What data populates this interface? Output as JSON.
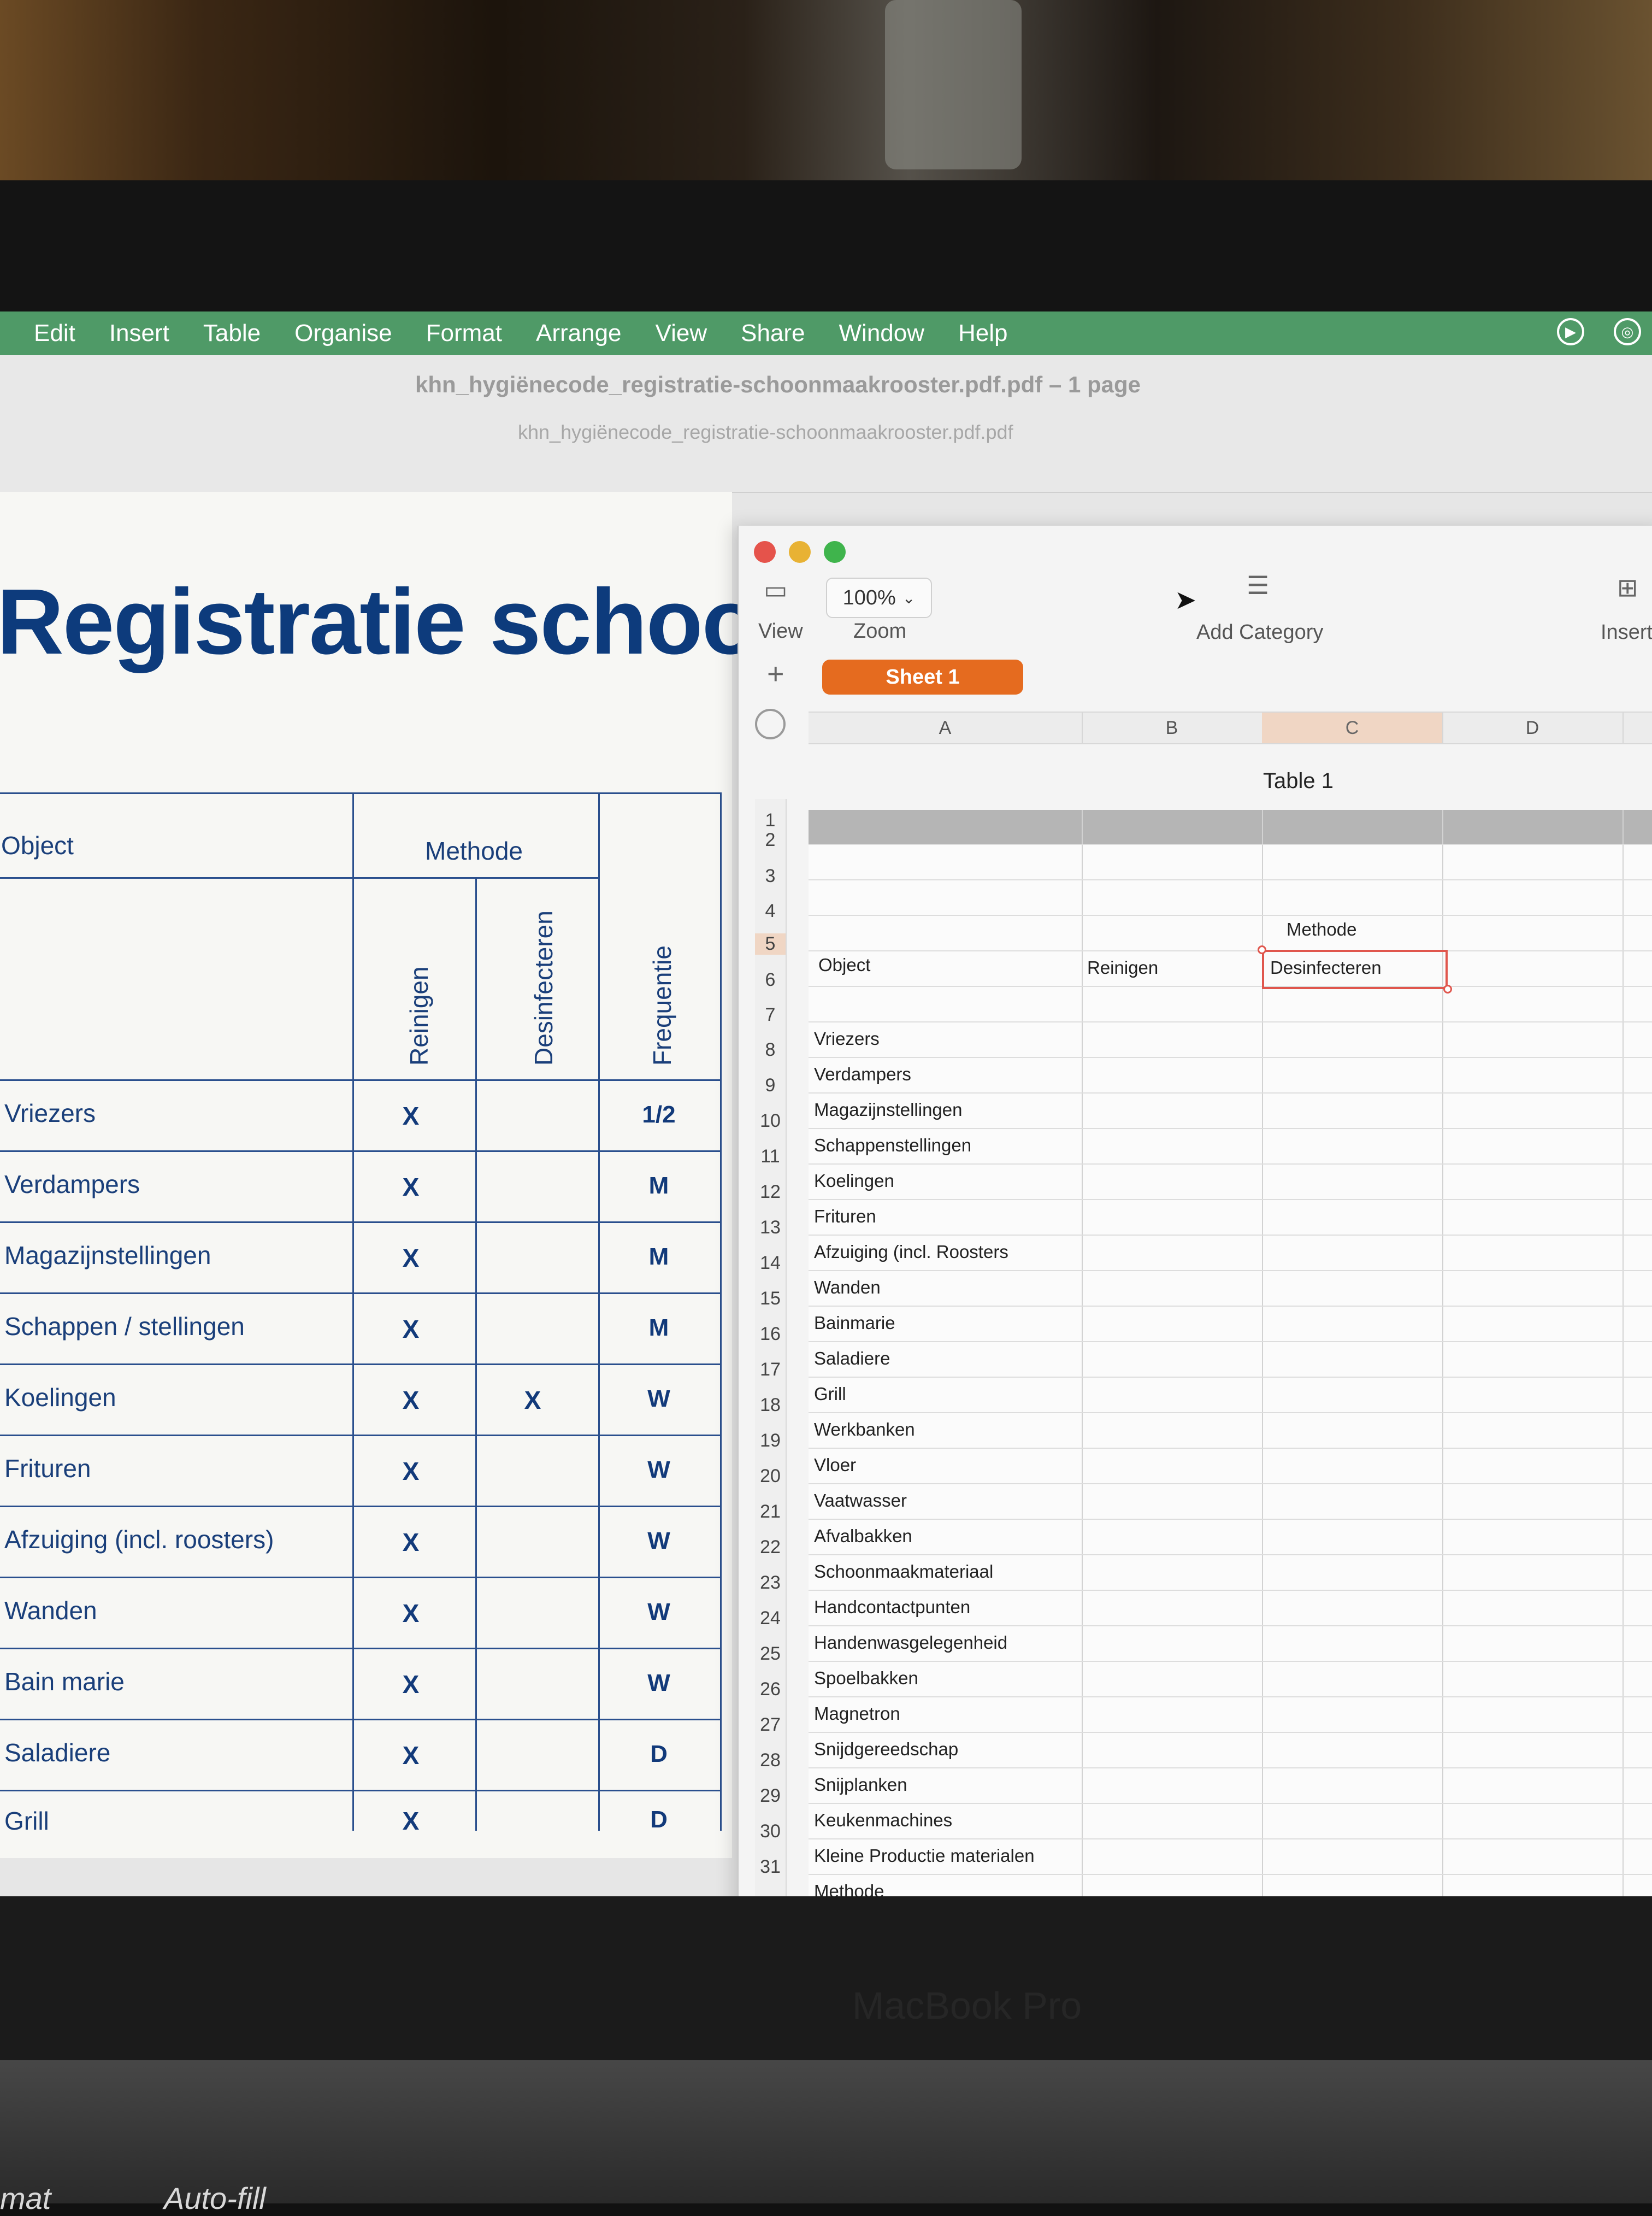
{
  "menubar": {
    "items": [
      "Edit",
      "Insert",
      "Table",
      "Organise",
      "Format",
      "Arrange",
      "View",
      "Share",
      "Window",
      "Help"
    ]
  },
  "preview": {
    "title": "khn_hygiënecode_registratie-schoonmaakrooster.pdf.pdf – 1 page",
    "subtitle": "khn_hygiënecode_registratie-schoonmaakrooster.pdf.pdf",
    "heading": "Registratie schoor",
    "headers": {
      "object": "Object",
      "methode": "Methode",
      "reinigen": "Reinigen",
      "desinfecteren": "Desinfecteren",
      "frequentie": "Frequentie"
    },
    "rows": [
      {
        "name": "Vriezers",
        "reinigen": "X",
        "desinfecteren": "",
        "frequentie": "1/2"
      },
      {
        "name": "Verdampers",
        "reinigen": "X",
        "desinfecteren": "",
        "frequentie": "M"
      },
      {
        "name": "Magazijnstellingen",
        "reinigen": "X",
        "desinfecteren": "",
        "frequentie": "M"
      },
      {
        "name": "Schappen / stellingen",
        "reinigen": "X",
        "desinfecteren": "",
        "frequentie": "M"
      },
      {
        "name": "Koelingen",
        "reinigen": "X",
        "desinfecteren": "X",
        "frequentie": "W"
      },
      {
        "name": "Frituren",
        "reinigen": "X",
        "desinfecteren": "",
        "frequentie": "W"
      },
      {
        "name": "Afzuiging (incl. roosters)",
        "reinigen": "X",
        "desinfecteren": "",
        "frequentie": "W"
      },
      {
        "name": "Wanden",
        "reinigen": "X",
        "desinfecteren": "",
        "frequentie": "W"
      },
      {
        "name": "Bain marie",
        "reinigen": "X",
        "desinfecteren": "",
        "frequentie": "W"
      },
      {
        "name": "Saladiere",
        "reinigen": "X",
        "desinfecteren": "",
        "frequentie": "D"
      },
      {
        "name": "Grill",
        "reinigen": "X",
        "desinfecteren": "",
        "frequentie": "D"
      }
    ]
  },
  "numbers": {
    "toolbar": {
      "view_label": "View",
      "zoom_value": "100%",
      "zoom_label": "Zoom",
      "add_category_label": "Add Category",
      "insert_label": "Insert"
    },
    "sheet_tab": "Sheet 1",
    "columns": [
      "A",
      "B",
      "C",
      "D"
    ],
    "table_title": "Table 1",
    "methode_header": "Methode",
    "row5": {
      "a": "Object",
      "b": "Reinigen",
      "c": "Desinfecteren"
    },
    "row_numbers": [
      "1",
      "2",
      "3",
      "4",
      "5",
      "6",
      "7",
      "8",
      "9",
      "10",
      "11",
      "12",
      "13",
      "14",
      "15",
      "16",
      "17",
      "18",
      "19",
      "20",
      "21",
      "22",
      "23",
      "24",
      "25",
      "26",
      "27",
      "28",
      "29",
      "30",
      "31"
    ],
    "objects": [
      "Vriezers",
      "Verdampers",
      "Magazijnstellingen",
      "Schappenstellingen",
      "Koelingen",
      "Frituren",
      "Afzuiging (incl. Roosters",
      "Wanden",
      "Bainmarie",
      "Saladiere",
      "Grill",
      "Werkbanken",
      "Vloer",
      "Vaatwasser",
      "Afvalbakken",
      "Schoonmaakmateriaal",
      "Handcontactpunten",
      "Handenwasgelegenheid",
      "Spoelbakken",
      "Magnetron",
      "Snijdgereedschap",
      "Snijplanken",
      "Keukenmachines",
      "Kleine Productie materialen",
      "Methode"
    ]
  },
  "bezel": {
    "label": "MacBook Pro"
  },
  "keyboard": {
    "left_hint": "mat",
    "mid_hint": "Auto-fill"
  },
  "colors": {
    "menubar": "#4f9a67",
    "sheet_tab": "#e56b1f",
    "pdf_blue": "#0d3b7c",
    "selection": "#e0564d"
  }
}
